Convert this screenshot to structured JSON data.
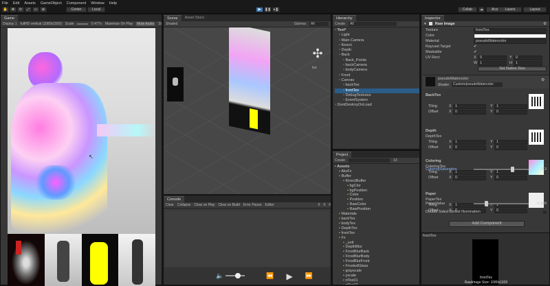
{
  "menu": [
    "File",
    "Edit",
    "Assets",
    "GameObject",
    "Component",
    "Window",
    "Help"
  ],
  "toolbar": {
    "center": "Center",
    "local": "Local",
    "collab": "Collab",
    "account": "Account",
    "layers": "Layers",
    "layout": "Layout"
  },
  "game": {
    "tab": "Game",
    "display": "Display 1",
    "resolution": "fullHD vertical (1080x1920)",
    "scale_label": "Scale",
    "scale_value": "0.477x",
    "maximize": "Maximize On Play",
    "mute": "Mute Audio",
    "stats": "St"
  },
  "scene": {
    "tab": "Scene",
    "asset_store": "Asset Store",
    "shaded": "Shaded",
    "gizmos": "Gizmos",
    "search": "All",
    "persp": "Iso"
  },
  "console": {
    "tab": "Console",
    "buttons": [
      "Clear",
      "Collapse",
      "Clear on Play",
      "Clear on Build",
      "Error Pause",
      "Editor"
    ],
    "counts": [
      "0",
      "0",
      "0"
    ]
  },
  "transport": {
    "volume_level": 0.55
  },
  "hierarchy": {
    "tab": "Hierarchy",
    "create": "Create",
    "search": "All",
    "items": [
      {
        "label": "Test*",
        "indent": 0,
        "bold": true
      },
      {
        "label": "Light",
        "indent": 1
      },
      {
        "label": "Main Camera",
        "indent": 1
      },
      {
        "label": "Kinect",
        "indent": 1
      },
      {
        "label": "Depth",
        "indent": 1
      },
      {
        "label": "Back",
        "indent": 1
      },
      {
        "label": "Back_Points",
        "indent": 2
      },
      {
        "label": "backCamera",
        "indent": 2
      },
      {
        "label": "bodyCamera",
        "indent": 2
      },
      {
        "label": "Front",
        "indent": 1
      },
      {
        "label": "Canvas",
        "indent": 1
      },
      {
        "label": "backTex",
        "indent": 2
      },
      {
        "label": "frontTex",
        "indent": 2,
        "selected": true
      },
      {
        "label": "DebugTextures",
        "indent": 2
      },
      {
        "label": "EventSystem",
        "indent": 2
      },
      {
        "label": "DontDestroyOnLoad",
        "indent": 0
      }
    ]
  },
  "project": {
    "tab": "Project",
    "create": "Create",
    "counter": "13",
    "items": [
      {
        "label": "Assets",
        "indent": 0,
        "bold": true
      },
      {
        "label": "AkvFx",
        "indent": 1
      },
      {
        "label": "Buffer",
        "indent": 1
      },
      {
        "label": "KinectBuffer",
        "indent": 2
      },
      {
        "label": "bgClor",
        "indent": 3
      },
      {
        "label": "bgPosition",
        "indent": 3
      },
      {
        "label": "Color",
        "indent": 3
      },
      {
        "label": "Position",
        "indent": 3
      },
      {
        "label": "RawColor",
        "indent": 3
      },
      {
        "label": "RawPosition",
        "indent": 3
      },
      {
        "label": "Materials",
        "indent": 1
      },
      {
        "label": "backTex",
        "indent": 1
      },
      {
        "label": "bodyTex",
        "indent": 1
      },
      {
        "label": "DepthTex",
        "indent": 1
      },
      {
        "label": "frontTex",
        "indent": 1
      },
      {
        "label": "Fx",
        "indent": 1
      },
      {
        "label": "_unit",
        "indent": 2
      },
      {
        "label": "DepthBlur",
        "indent": 2
      },
      {
        "label": "FrostBlurBack",
        "indent": 2
      },
      {
        "label": "FrostBlurBody",
        "indent": 2
      },
      {
        "label": "FrostBlurFront",
        "indent": 2
      },
      {
        "label": "FrostedGlass",
        "indent": 2
      },
      {
        "label": "grayscale",
        "indent": 2
      },
      {
        "label": "yscale",
        "indent": 2
      },
      {
        "label": "rtTex01",
        "indent": 2
      },
      {
        "label": "rtTex02",
        "indent": 2
      }
    ]
  },
  "inspector": {
    "tab": "Inspector",
    "component": "Raw Image",
    "texture_label": "Texture",
    "texture_value": "frontTex",
    "color_label": "Color",
    "material_label": "Material",
    "material_value": "pseudoWatercolor",
    "raycast_label": "Raycast Target",
    "maskable_label": "Maskable",
    "uvrect_label": "UV Rect",
    "uv_x": "0",
    "uv_y": "0",
    "uv_w": "1",
    "uv_h": "1",
    "native_size": "Set Native Size",
    "mat_name": "pseudoWatercolor",
    "shader_label": "Shader",
    "shader_value": "Custom/pseudoWatercolor",
    "sections": [
      {
        "title": "BackTex",
        "sub": "",
        "tiling": [
          "1",
          "1"
        ],
        "offset": [
          "0",
          "0"
        ]
      },
      {
        "title": "Depth",
        "sub": "DepthTex",
        "tiling": [
          "1",
          "1"
        ],
        "offset": [
          "0",
          "0"
        ]
      },
      {
        "title": "Coloring",
        "sub": "ColoringTex",
        "tiling": [
          "1",
          "1"
        ],
        "offset": [
          "0",
          "0"
        ]
      },
      {
        "title": "Paper",
        "sub": "PaperTex",
        "tiling": [
          "1",
          "1"
        ],
        "offset": [
          "0",
          "0"
        ]
      }
    ],
    "tiling_label": "Tiling",
    "offset_label": "Offset",
    "x_label": "X",
    "y_label": "Y",
    "sat_label": "ColoringSaturation",
    "sat_value": "3.3",
    "sat_level": 0.7,
    "paper_value_label": "PaperValue",
    "paper_value": "0.149",
    "paper_level": 0.22,
    "double_sided": "Double Sided Global Illumination",
    "add_component": "Add Component",
    "preview_tab": "frontTex",
    "preview_name": "frontTex",
    "preview_size": "RawImage Size: 1080x1920"
  },
  "colors": {
    "accent": "#3a79bb",
    "selection": "#2c5d87",
    "panel": "#383838",
    "yellow": "#ffff00"
  }
}
